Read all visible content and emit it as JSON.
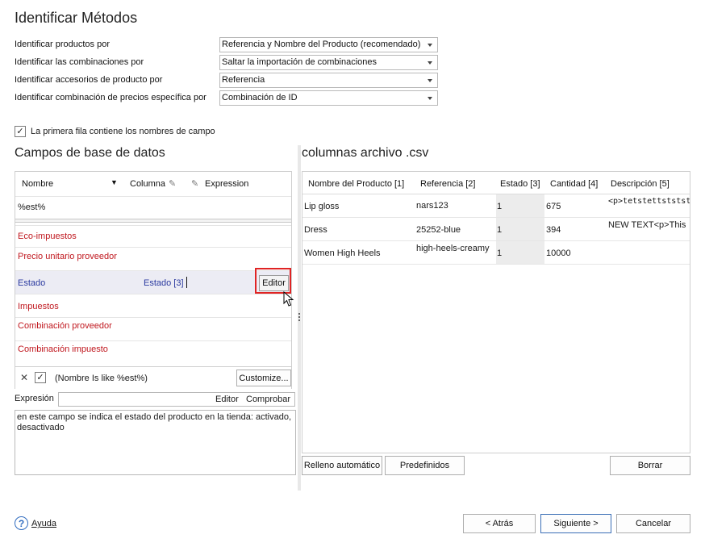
{
  "title": "Identificar Métodos",
  "settings": [
    {
      "label": "Identificar productos por",
      "value": "Referencia y Nombre del Producto (recomendado)"
    },
    {
      "label": "Identificar las combinaciones por",
      "value": "Saltar la importación de combinaciones"
    },
    {
      "label": "Identificar accesorios de producto por",
      "value": "Referencia"
    },
    {
      "label": "Identificar combinación de precios específica por",
      "value": "Combinación de ID"
    }
  ],
  "first_row_checkbox": {
    "label": "La primera fila contiene los nombres de campo",
    "checked": true
  },
  "db_fields": {
    "title": "Campos de base de datos",
    "columns": {
      "name": "Nombre",
      "column": "Columna",
      "expression": "Expression"
    },
    "filter_value": "%est%",
    "rows": [
      {
        "name": "Eco-impuestos",
        "column": ""
      },
      {
        "name": "Precio unitario proveedor",
        "column": ""
      },
      {
        "name": "Estado",
        "column": "Estado [3]",
        "selected": true
      },
      {
        "name": "Impuestos",
        "column": ""
      },
      {
        "name": "Combinación proveedor",
        "column": ""
      },
      {
        "name": "Combinación impuesto",
        "column": ""
      }
    ],
    "editor_label": "Editor",
    "filter_text": "(Nombre Is like %est%)",
    "customize_label": "Customize..."
  },
  "expression": {
    "label": "Expresión",
    "editor_label": "Editor",
    "check_label": "Comprobar",
    "description": "en este campo se indica el estado del producto en la tienda: activado, desactivado"
  },
  "csv": {
    "title": "columnas archivo .csv",
    "headers": [
      "Nombre del Producto [1]",
      "Referencia [2]",
      "Estado [3]",
      "Cantidad [4]",
      "Descripción [5]"
    ],
    "rows": [
      [
        "Lip gloss",
        "nars123",
        "1",
        "675",
        "<p>tetstettstststs</"
      ],
      [
        "Dress",
        "25252-blue",
        "1",
        "394",
        "NEW TEXT<p>This"
      ],
      [
        "Women High Heels",
        "high-heels-creamy",
        "1",
        "10000",
        ""
      ]
    ],
    "autofill_label": "Relleno automático",
    "predefined_label": "Predefinidos",
    "clear_label": "Borrar"
  },
  "footer": {
    "help_label": "Ayuda",
    "back_label": "< Atrás",
    "next_label": "Siguiente >",
    "cancel_label": "Cancelar"
  },
  "colors": {
    "required_field": "#c0171e",
    "selected_field": "#2b3aa0",
    "highlight_box": "#e02424"
  }
}
